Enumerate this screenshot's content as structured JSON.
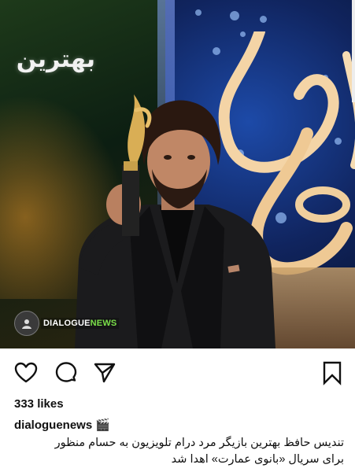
{
  "post": {
    "photo": {
      "banner_text": "بهترین",
      "watermark": {
        "prefix": "DIALOGUE",
        "suffix": "NEWS"
      }
    },
    "actions": {
      "like_icon": "heart-outline-icon",
      "comment_icon": "comment-bubble-icon",
      "share_icon": "paper-plane-icon",
      "save_icon": "bookmark-outline-icon"
    },
    "likes_text": "333 likes",
    "username": "dialoguenews",
    "username_emoji": "🎬",
    "caption_line1": "تندیس حافظ بهترین بازیگر مرد درام تلویزیون به حسام منظور",
    "caption_line2": "برای سریال «بانوی عمارت» اهدا شد"
  },
  "colors": {
    "text": "#111111",
    "watermark_accent": "#7be04a",
    "background": "#ffffff"
  }
}
